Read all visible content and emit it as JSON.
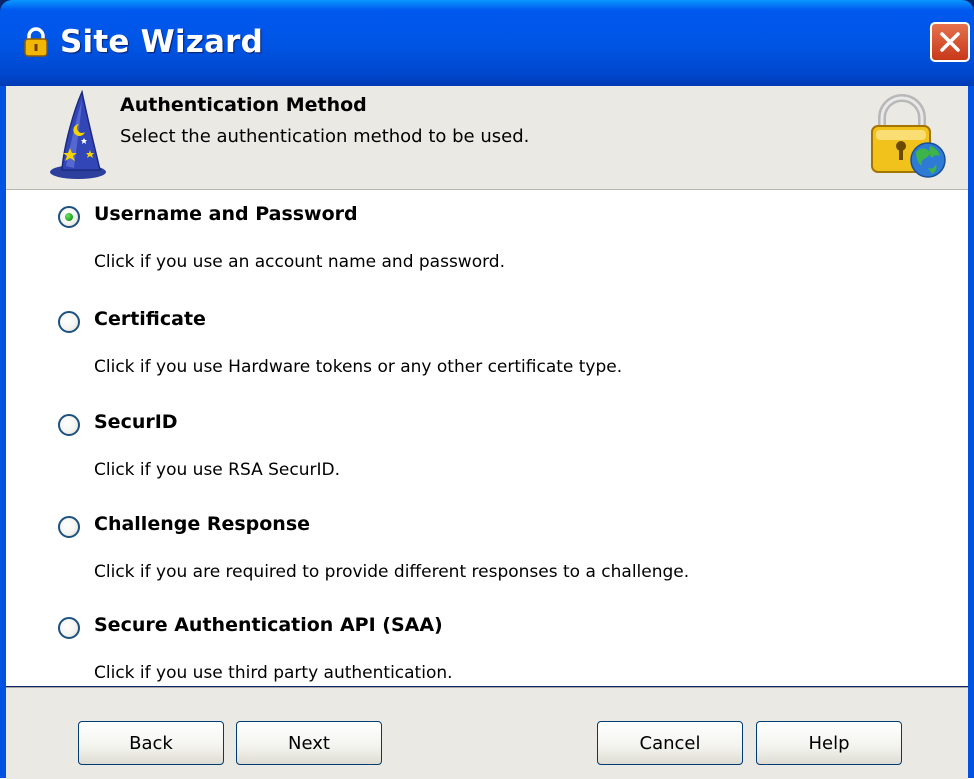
{
  "window": {
    "title": "Site Wizard",
    "close_icon": "close-icon"
  },
  "header": {
    "title": "Authentication Method",
    "subtitle": "Select the authentication method to be used."
  },
  "options": [
    {
      "label": "Username and Password",
      "description": "Click if you use an account name and password.",
      "selected": true
    },
    {
      "label": "Certificate",
      "description": "Click if you use Hardware tokens or any other certificate type.",
      "selected": false
    },
    {
      "label": "SecurID",
      "description": "Click if you use RSA SecurID.",
      "selected": false
    },
    {
      "label": "Challenge Response",
      "description": "Click if you are required to provide different responses to a challenge.",
      "selected": false
    },
    {
      "label": "Secure Authentication API (SAA)",
      "description": "Click if you use third party authentication.",
      "selected": false
    }
  ],
  "buttons": {
    "back": "Back",
    "next": "Next",
    "cancel": "Cancel",
    "help": "Help"
  },
  "colors": {
    "titlebar": "#0055e5",
    "panel": "#ebe9e3",
    "radio_selected": "#17a317"
  }
}
